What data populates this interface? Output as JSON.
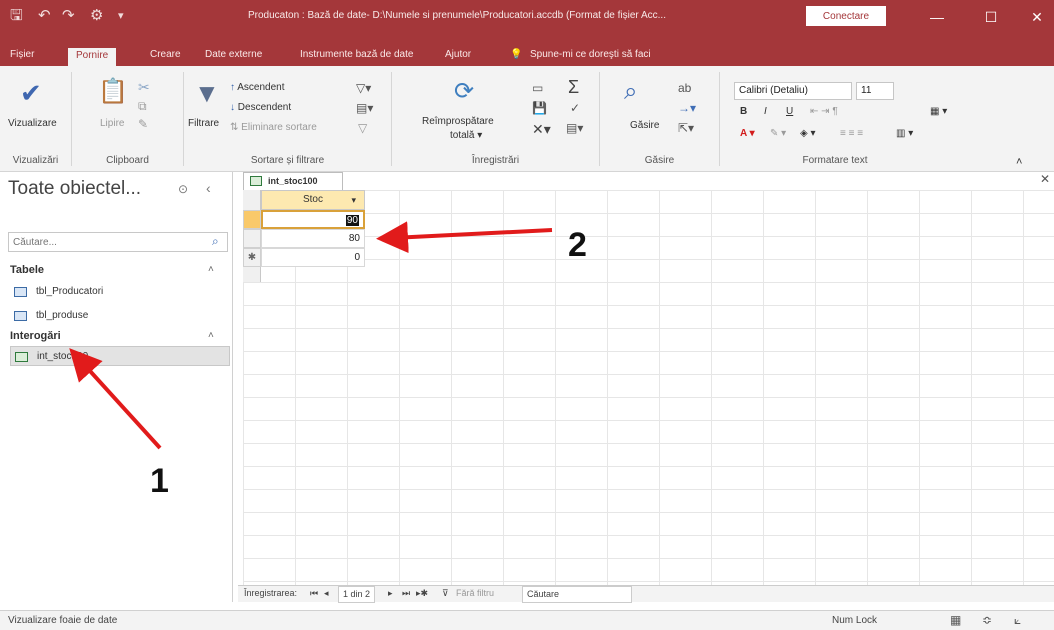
{
  "titlebar": {
    "title": "Producaton : Bază de date- D:\\Numele si prenumele\\Producatori.accdb (Format de fișier Acc...",
    "connect_label": "Conectare",
    "save_icon": "save-icon",
    "minimize": "—",
    "restore": "☐",
    "close": "✕"
  },
  "tabs": [
    "Fișier",
    "Pornire",
    "Creare",
    "Date externe",
    "Instrumente bază de date",
    "Ajutor"
  ],
  "tell_me": "Spune-mi ce doreşti să faci",
  "ribbon": {
    "groups": {
      "views": "Vizualizări",
      "clipboard": "Clipboard",
      "sort_filter": "Sortare și filtrare",
      "records": "Înregistrări",
      "find": "Găsire",
      "text_format": "Formatare text"
    },
    "view_label": "Vizualizare",
    "paste_label": "Lipire",
    "filter_label": "Filtrare",
    "ascending_label": "Ascendent",
    "descending_label": "Descendent",
    "remove_sort_label": "Eliminare sortare",
    "refresh_label_1": "Reîmprospătare",
    "refresh_label_2": "totală",
    "find_label": "Găsire",
    "font_name": "Calibri (Detaliu)",
    "font_size": "11"
  },
  "nav": {
    "title": "Toate obiectel...",
    "search_placeholder": "Căutare...",
    "sections": [
      {
        "name": "Tabele",
        "items": [
          "tbl_Producatori",
          "tbl_produse"
        ]
      },
      {
        "name": "Interogări",
        "items": [
          "int_stoc100"
        ]
      }
    ]
  },
  "document": {
    "tab_label": "int_stoc100",
    "column_header": "Stoc",
    "rows": [
      "90",
      "80"
    ],
    "new_row_value": "0"
  },
  "record_nav": {
    "label": "Înregistrarea:",
    "position": "1 din 2",
    "filter_label": "Fără filtru",
    "search_label": "Căutare"
  },
  "status": {
    "left": "Vizualizare foaie de date",
    "numlock": "Num Lock"
  },
  "annotations": [
    "1",
    "2"
  ],
  "colors": {
    "access_red": "#a4373a",
    "arrow_red": "#e11b1b"
  }
}
